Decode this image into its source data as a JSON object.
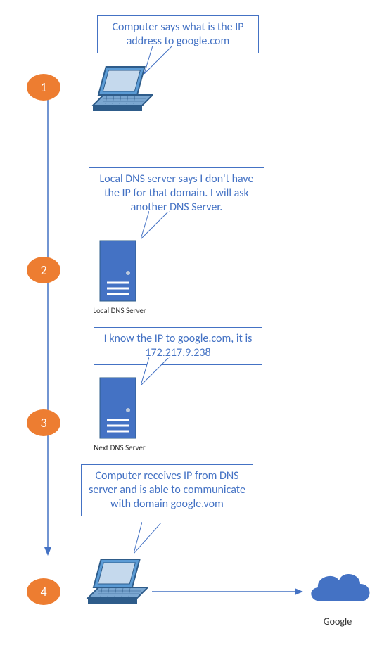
{
  "steps": [
    {
      "num": "1",
      "bubble": "Computer says what is the IP address to google.com"
    },
    {
      "num": "2",
      "bubble": "Local DNS server says I don't have the IP for that domain. I will ask another DNS Server.",
      "label": "Local DNS Server"
    },
    {
      "num": "3",
      "bubble": "I know the IP to google.com, it is 172.217.9.238",
      "label": "Next DNS Server"
    },
    {
      "num": "4",
      "bubble": "Computer receives IP from DNS server and is able to communicate with domain google.vom",
      "cloud_label": "Google"
    }
  ]
}
